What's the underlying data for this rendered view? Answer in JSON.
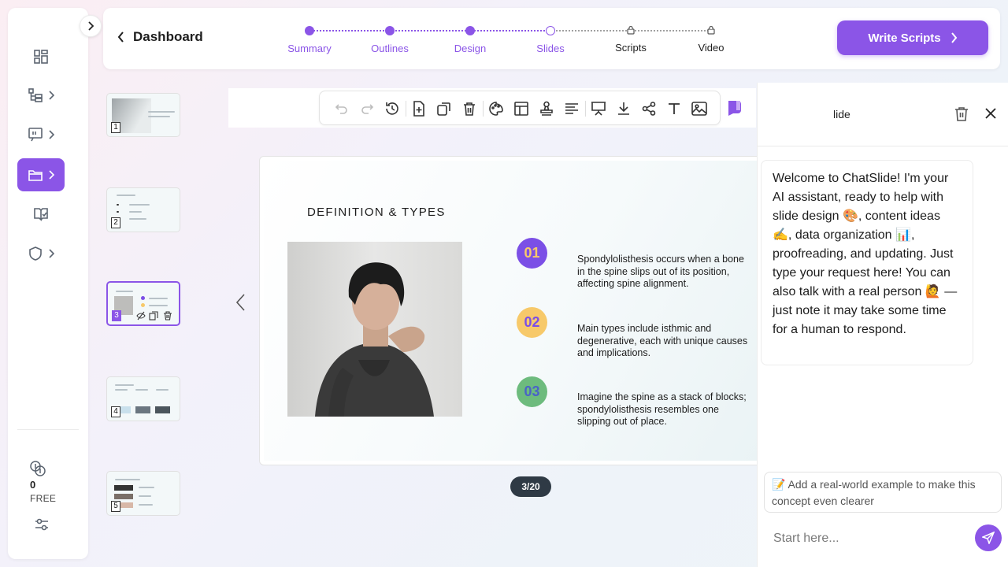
{
  "colors": {
    "accent": "#8b55e7",
    "badge1": "#7b4fe6",
    "badge2": "#f7c96a",
    "badge3": "#6dbb7d",
    "pager": "#2f3a45"
  },
  "sidebar": {
    "items": [
      {
        "icon": "dashboard-grid-icon",
        "active": false
      },
      {
        "icon": "outline-tree-icon",
        "active": false
      },
      {
        "icon": "presentation-icon",
        "active": false
      },
      {
        "icon": "folder-icon",
        "active": true
      },
      {
        "icon": "book-check-icon",
        "active": false
      },
      {
        "icon": "shield-icon",
        "active": false
      }
    ],
    "credits": {
      "count": "0",
      "plan": "FREE"
    }
  },
  "header": {
    "back_label": "Dashboard",
    "steps": [
      {
        "label": "Summary",
        "state": "done"
      },
      {
        "label": "Outlines",
        "state": "done"
      },
      {
        "label": "Design",
        "state": "done"
      },
      {
        "label": "Slides",
        "state": "current"
      },
      {
        "label": "Scripts",
        "state": "locked"
      },
      {
        "label": "Video",
        "state": "locked"
      }
    ],
    "cta_label": "Write Scripts"
  },
  "thumbnails": [
    {
      "num": "1"
    },
    {
      "num": "2"
    },
    {
      "num": "3"
    },
    {
      "num": "4"
    },
    {
      "num": "5"
    }
  ],
  "slide": {
    "title": "DEFINITION & TYPES",
    "points": [
      {
        "badge": "01",
        "text": "Spondylolisthesis occurs when a bone in the spine slips out of its position, affecting spine alignment."
      },
      {
        "badge": "02",
        "text": "Main types include isthmic and degenerative, each with unique causes and implications."
      },
      {
        "badge": "03",
        "text": "Imagine the spine as a stack of blocks; spondylolisthesis resembles one slipping out of place."
      }
    ],
    "pager": "3/20"
  },
  "chat": {
    "title": "lide",
    "message": "Welcome to ChatSlide! I'm your AI assistant, ready to help with slide design 🎨, content ideas ✍️, data organization 📊, proofreading, and updating. Just type your request here! You can also talk with a real person 🙋 — just note it may take some time for a human to respond.",
    "suggestion": "📝 Add a real-world example to make this concept even clearer",
    "input_placeholder": "Start here..."
  }
}
